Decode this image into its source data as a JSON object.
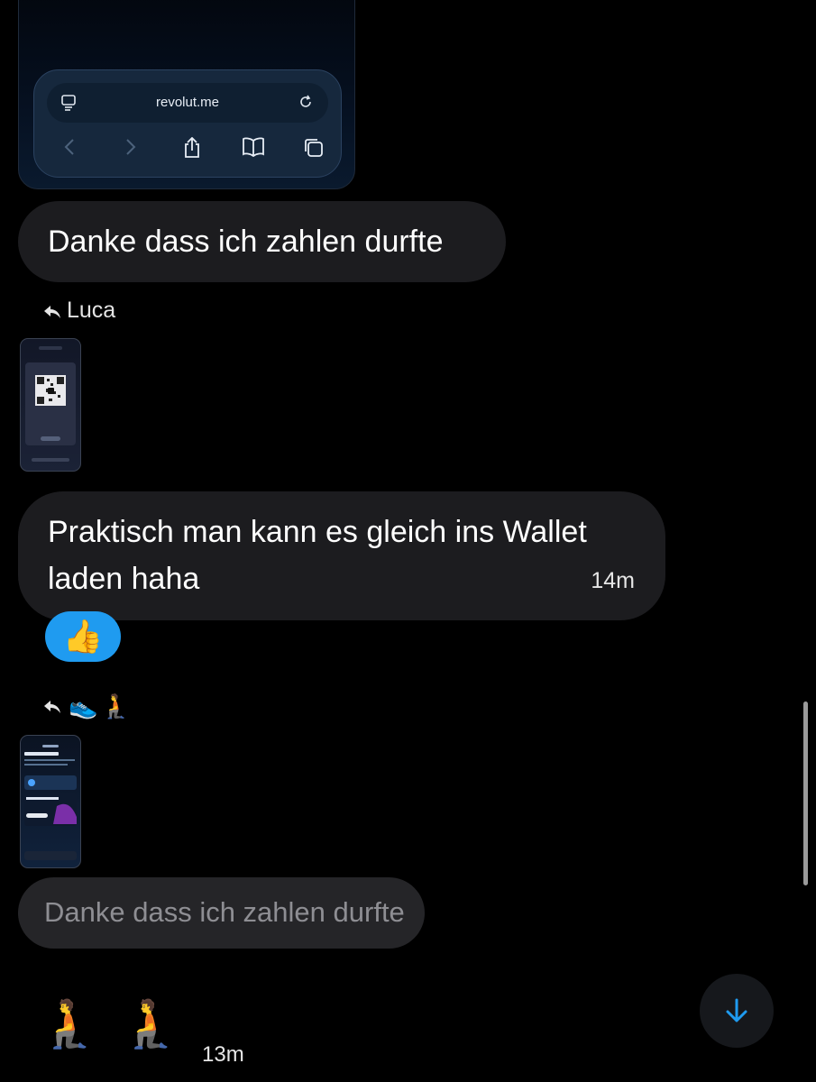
{
  "top_card": {
    "url": "revolut.me",
    "icons": [
      "page-settings-icon",
      "reload-icon",
      "back-icon",
      "forward-icon",
      "share-icon",
      "bookmarks-icon",
      "tabs-icon"
    ]
  },
  "messages": [
    {
      "text": "Danke dass ich zahlen durfte"
    },
    {
      "text": "Praktisch man kann es gleich ins Wallet laden haha",
      "time": "14m"
    }
  ],
  "reply": {
    "label": "Luca"
  },
  "reaction": {
    "emoji": "👍",
    "color": "#1f9bf0"
  },
  "reaction_row": {
    "emojis": [
      "👟",
      "🧎"
    ]
  },
  "draft": {
    "text": "Danke dass ich zahlen durfte"
  },
  "bottom": {
    "emojis": [
      "🧎",
      "🧎"
    ],
    "time": "13m"
  },
  "colors": {
    "accent": "#1f9bf0",
    "bubble": "#1c1c1f",
    "background": "#000000"
  }
}
